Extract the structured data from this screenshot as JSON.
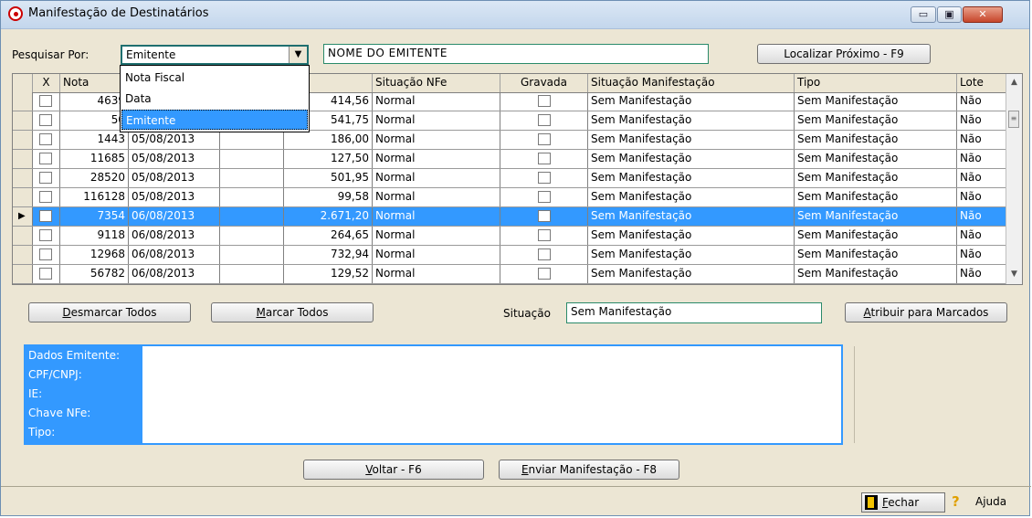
{
  "window": {
    "title": "Manifestação de Destinatários",
    "min_symbol": "▭",
    "max_symbol": "▣",
    "close_symbol": "✕"
  },
  "search": {
    "label": "Pesquisar Por:",
    "selected": "Emitente",
    "arrow": "▼",
    "text_value": "NOME DO EMITENTE",
    "find_next_label": "Localizar Próximo - F9",
    "options": [
      "Nota Fiscal",
      "Data",
      "Emitente"
    ]
  },
  "grid": {
    "headers": {
      "check": "X",
      "nota": "Nota",
      "data": "",
      "emitente": "",
      "valor": "or",
      "situacao_nfe": "Situação NFe",
      "gravada": "Gravada",
      "situacao_manifestacao": "Situação Manifestação",
      "tipo": "Tipo",
      "lote": "Lote"
    },
    "rows": [
      {
        "nota": "4639",
        "data": "",
        "valor": "414,56",
        "sit": "Normal",
        "man": "Sem Manifestação",
        "tipo": "Sem Manifestação",
        "lote": "Não"
      },
      {
        "nota": "50",
        "data": "",
        "valor": "541,75",
        "sit": "Normal",
        "man": "Sem Manifestação",
        "tipo": "Sem Manifestação",
        "lote": "Não"
      },
      {
        "nota": "1443",
        "data": "05/08/2013",
        "valor": "186,00",
        "sit": "Normal",
        "man": "Sem Manifestação",
        "tipo": "Sem Manifestação",
        "lote": "Não"
      },
      {
        "nota": "11685",
        "data": "05/08/2013",
        "valor": "127,50",
        "sit": "Normal",
        "man": "Sem Manifestação",
        "tipo": "Sem Manifestação",
        "lote": "Não"
      },
      {
        "nota": "28520",
        "data": "05/08/2013",
        "valor": "501,95",
        "sit": "Normal",
        "man": "Sem Manifestação",
        "tipo": "Sem Manifestação",
        "lote": "Não"
      },
      {
        "nota": "116128",
        "data": "05/08/2013",
        "valor": "99,58",
        "sit": "Normal",
        "man": "Sem Manifestação",
        "tipo": "Sem Manifestação",
        "lote": "Não"
      },
      {
        "nota": "7354",
        "data": "06/08/2013",
        "valor": "2.671,20",
        "sit": "Normal",
        "man": "Sem Manifestação",
        "tipo": "Sem Manifestação",
        "lote": "Não"
      },
      {
        "nota": "9118",
        "data": "06/08/2013",
        "valor": "264,65",
        "sit": "Normal",
        "man": "Sem Manifestação",
        "tipo": "Sem Manifestação",
        "lote": "Não"
      },
      {
        "nota": "12968",
        "data": "06/08/2013",
        "valor": "732,94",
        "sit": "Normal",
        "man": "Sem Manifestação",
        "tipo": "Sem Manifestação",
        "lote": "Não"
      },
      {
        "nota": "56782",
        "data": "06/08/2013",
        "valor": "129,52",
        "sit": "Normal",
        "man": "Sem Manifestação",
        "tipo": "Sem Manifestação",
        "lote": "Não"
      }
    ],
    "row_indicator": "▶",
    "scroll_up": "▲",
    "scroll_down": "▼",
    "scroll_thumb": "≡"
  },
  "actions": {
    "desmarcar_pre": "",
    "desmarcar_key": "D",
    "desmarcar_rest": "esmarcar Todos",
    "marcar_key": "M",
    "marcar_rest": "arcar Todos",
    "situacao_label": "Situação",
    "situacao_value": "Sem Manifestação",
    "atribuir_key": "A",
    "atribuir_rest": "tribuir para Marcados"
  },
  "info": {
    "labels": [
      "Dados Emitente:",
      "CPF/CNPJ:",
      "IE:",
      "Chave NFe:",
      "Tipo:"
    ]
  },
  "bottom": {
    "voltar_key": "V",
    "voltar_rest": "oltar - F6",
    "enviar_key": "E",
    "enviar_rest": "nviar Manifestação - F8"
  },
  "footer": {
    "fechar_key": "F",
    "fechar_rest": "echar",
    "ajuda_icon": "?",
    "ajuda_label": "Ajuda"
  }
}
